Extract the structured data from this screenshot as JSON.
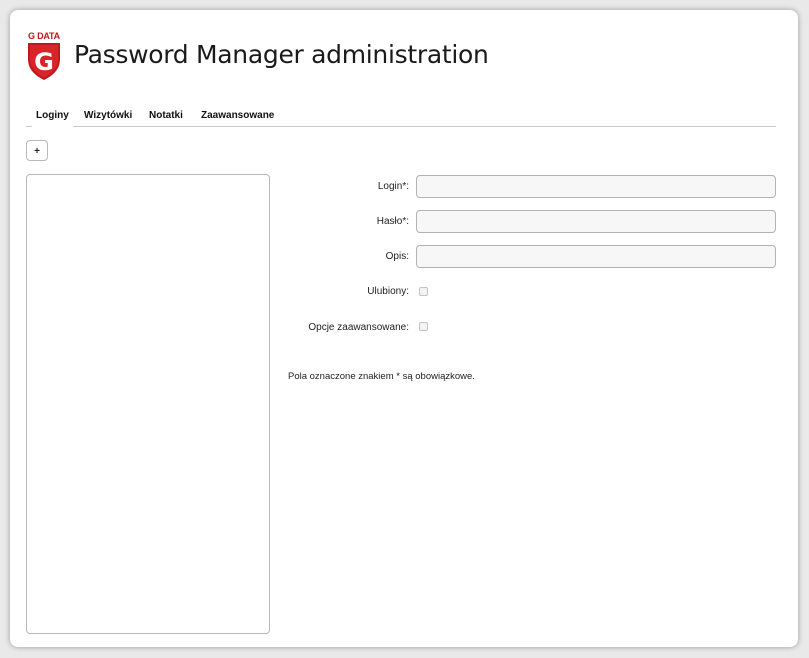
{
  "header": {
    "logo_text": "G DATA",
    "title": "Password Manager administration"
  },
  "tabs": [
    {
      "label": "Loginy",
      "active": true
    },
    {
      "label": "Wizytówki",
      "active": false
    },
    {
      "label": "Notatki",
      "active": false
    },
    {
      "label": "Zaawansowane",
      "active": false
    }
  ],
  "toolbar": {
    "add_label": "+"
  },
  "form": {
    "login_label": "Login*:",
    "login_value": "",
    "password_label": "Hasło*:",
    "password_value": "",
    "description_label": "Opis:",
    "description_value": "",
    "favorite_label": "Ulubiony:",
    "favorite_checked": false,
    "advanced_label": "Opcje zaawansowane:",
    "advanced_checked": false,
    "required_note": "Pola oznaczone znakiem * są obowiązkowe."
  },
  "colors": {
    "brand_red": "#c0191b",
    "background": "#e9e9e9",
    "card": "#ffffff"
  }
}
